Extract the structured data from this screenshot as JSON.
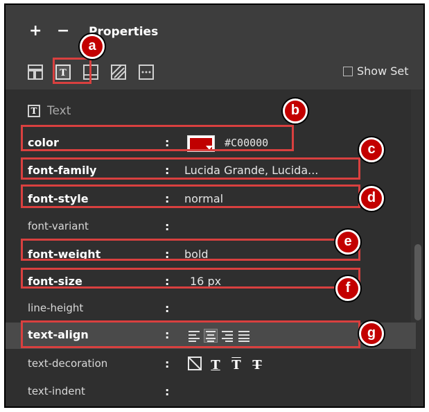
{
  "toolbar": {
    "add_label": "+",
    "remove_label": "−",
    "title": "Properties",
    "show_set_label": "Show Set"
  },
  "section": {
    "title": "Text"
  },
  "properties": [
    {
      "name": "color",
      "value": "#C00000",
      "swatch_color": "#c00000"
    },
    {
      "name": "font-family",
      "value": "Lucida Grande, Lucida..."
    },
    {
      "name": "font-style",
      "value": "normal"
    },
    {
      "name": "font-variant",
      "value": ""
    },
    {
      "name": "font-weight",
      "value": "bold"
    },
    {
      "name": "font-size",
      "value": "16 px"
    },
    {
      "name": "line-height",
      "value": ""
    },
    {
      "name": "text-align",
      "value": ""
    },
    {
      "name": "text-decoration",
      "value": ""
    },
    {
      "name": "text-indent",
      "value": ""
    }
  ],
  "separator": ":",
  "text_decoration_options": [
    "T",
    "T",
    "T"
  ],
  "annotations": [
    "a",
    "b",
    "c",
    "d",
    "e",
    "f",
    "g"
  ],
  "colors": {
    "panel": "#2b2b2b",
    "header": "#3d3d3d",
    "highlight": "#c30000",
    "box": "#d9403f"
  }
}
